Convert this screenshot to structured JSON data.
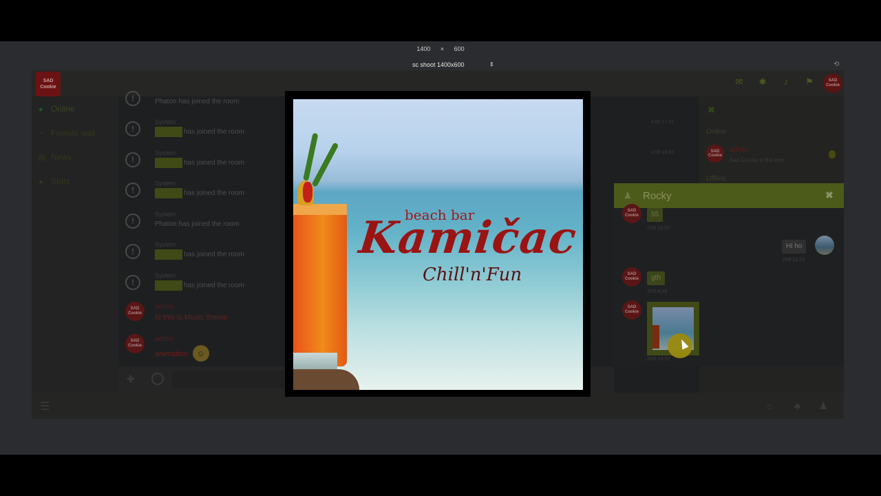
{
  "devtools": {
    "width": "1400",
    "times": "×",
    "height": "600",
    "device": "sc shoot 1400x600",
    "device_arrows": "⇕"
  },
  "header": {
    "logo_line1": "SAD",
    "logo_line2": "Cookie",
    "icons": [
      "envelope-icon",
      "paw-icon",
      "bell-icon",
      "flag-icon"
    ],
    "avatar_line1": "SAD",
    "avatar_line2": "Cookie"
  },
  "sidebar": {
    "items": [
      {
        "label": "Online",
        "icon": "●"
      },
      {
        "label": "Friends wall",
        "icon": "◔"
      },
      {
        "label": "News",
        "icon": "▤"
      },
      {
        "label": "Stats",
        "icon": "●"
      }
    ]
  },
  "chat": {
    "messages": [
      {
        "kind": "system",
        "from": "",
        "text": "Phaton has joined the room"
      },
      {
        "kind": "system",
        "from": "System",
        "text": "has joined the room"
      },
      {
        "kind": "system",
        "from": "System",
        "text": "has joined the room"
      },
      {
        "kind": "system",
        "from": "System",
        "text": "has joined the room"
      },
      {
        "kind": "system",
        "from": "System",
        "text": "Phaton has joined the room"
      },
      {
        "kind": "system",
        "from": "System",
        "text": "has joined the room"
      },
      {
        "kind": "system",
        "from": "System",
        "text": "has joined the room"
      },
      {
        "kind": "user",
        "from": "admin",
        "text": "hi this is Music theme"
      },
      {
        "kind": "user",
        "from": "admin",
        "text": "animation"
      }
    ],
    "times": [
      "4:00 17:45",
      "4:00 18:45"
    ],
    "avatar_line1": "SAD",
    "avatar_line2": "Cookie"
  },
  "right_panel": {
    "online_label": "Online",
    "offline_label": "Offline",
    "admin_name": "admin",
    "admin_status": "Sad Cookie is the best"
  },
  "private_chat": {
    "title": "Rocky",
    "close": "✖",
    "messages": [
      {
        "side": "left",
        "text": "55",
        "time": "2/06 19:52"
      },
      {
        "side": "right",
        "text": "Hi ho",
        "time": "2/06 21:24"
      },
      {
        "side": "left",
        "text": "gth",
        "time": "3/06 8:29"
      },
      {
        "side": "left",
        "text": "",
        "time": "3/06 14:32"
      }
    ]
  },
  "lightbox": {
    "brand_top": "beach bar",
    "brand_main": "Kamičac",
    "brand_sub": "Chill'n'Fun"
  },
  "colors": {
    "accent": "#4c5a1a",
    "admin": "#6a1e1e",
    "background": "#1f2123"
  }
}
